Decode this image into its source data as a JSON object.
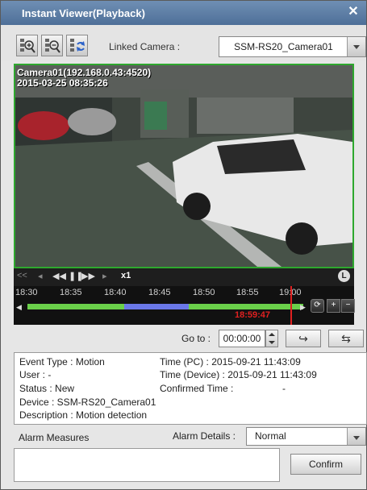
{
  "window": {
    "title": "Instant Viewer(Playback)",
    "close_icon": "close-icon"
  },
  "toolbar": {
    "zoom_in_icon": "zoom-in-icon",
    "zoom_out_icon": "zoom-out-icon",
    "refresh_icon": "grid-refresh-icon",
    "linked_camera_label": "Linked Camera :",
    "linked_camera_value": "SSM-RS20_Camera01"
  },
  "video": {
    "camera_line": "Camera01(192.168.0.43:4520)",
    "timestamp": "2015-03-25 08:35:26"
  },
  "playback": {
    "speed": "x1",
    "live_badge": "L",
    "icons": [
      "rewind-to-start-icon",
      "step-back-icon",
      "fast-rewind-icon",
      "pause-icon",
      "fast-forward-icon",
      "step-forward-icon"
    ]
  },
  "timeline": {
    "ticks": [
      "18:30",
      "18:35",
      "18:40",
      "18:45",
      "18:50",
      "18:55",
      "19:00"
    ],
    "current_time": "18:59:47"
  },
  "goto": {
    "label": "Go to :",
    "value": "00:00:00"
  },
  "event": {
    "type": "Event Type : Motion",
    "user": "User : -",
    "status": "Status : New",
    "device": "Device : SSM-RS20_Camera01",
    "description": "Description : Motion detection",
    "time_pc": "Time (PC) : 2015-09-21 11:43:09",
    "time_device": "Time (Device) : 2015-09-21 11:43:09",
    "confirmed_time": "Confirmed Time :",
    "confirmed_value": "-"
  },
  "alarm": {
    "measures_label": "Alarm Measures",
    "details_label": "Alarm Details :",
    "details_value": "Normal",
    "confirm_label": "Confirm"
  },
  "colors": {
    "title_bar": "#5b7ca5",
    "video_border": "#2ea82e",
    "timeline_cursor": "#e02020",
    "timeline_green": "#6ad04a",
    "timeline_blue": "#6a78e8"
  }
}
